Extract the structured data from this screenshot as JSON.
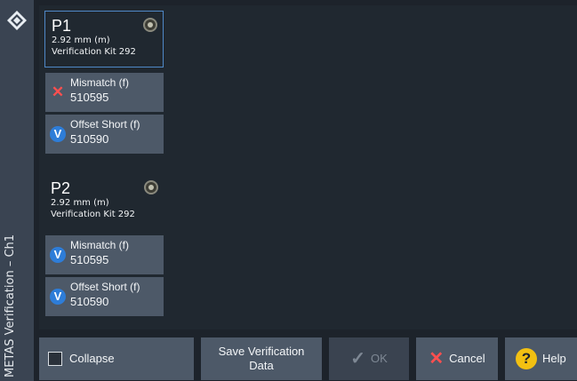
{
  "window": {
    "title": "METAS Verification – Ch1"
  },
  "ports": [
    {
      "name": "P1",
      "connector": "2.92 mm (m)",
      "kit": "Verification Kit 292",
      "standards": [
        {
          "name": "Mismatch (f)",
          "serial": "510595",
          "status_icon": "x-icon"
        },
        {
          "name": "Offset Short (f)",
          "serial": "510590",
          "status_icon": "v-icon"
        }
      ]
    },
    {
      "name": "P2",
      "connector": "2.92 mm (m)",
      "kit": "Verification Kit 292",
      "standards": [
        {
          "name": "Mismatch (f)",
          "serial": "510595",
          "status_icon": "v-icon"
        },
        {
          "name": "Offset Short (f)",
          "serial": "510590",
          "status_icon": "v-icon"
        }
      ]
    }
  ],
  "buttons": {
    "collapse": "Collapse",
    "save_line1": "Save Verification",
    "save_line2": "Data",
    "ok": "OK",
    "cancel": "Cancel",
    "help": "Help"
  },
  "colors": {
    "accent_blue": "#2e7dd8",
    "error_red": "#ff4f4f",
    "help_yellow": "#f2c012",
    "button_bg": "#4d5968"
  }
}
